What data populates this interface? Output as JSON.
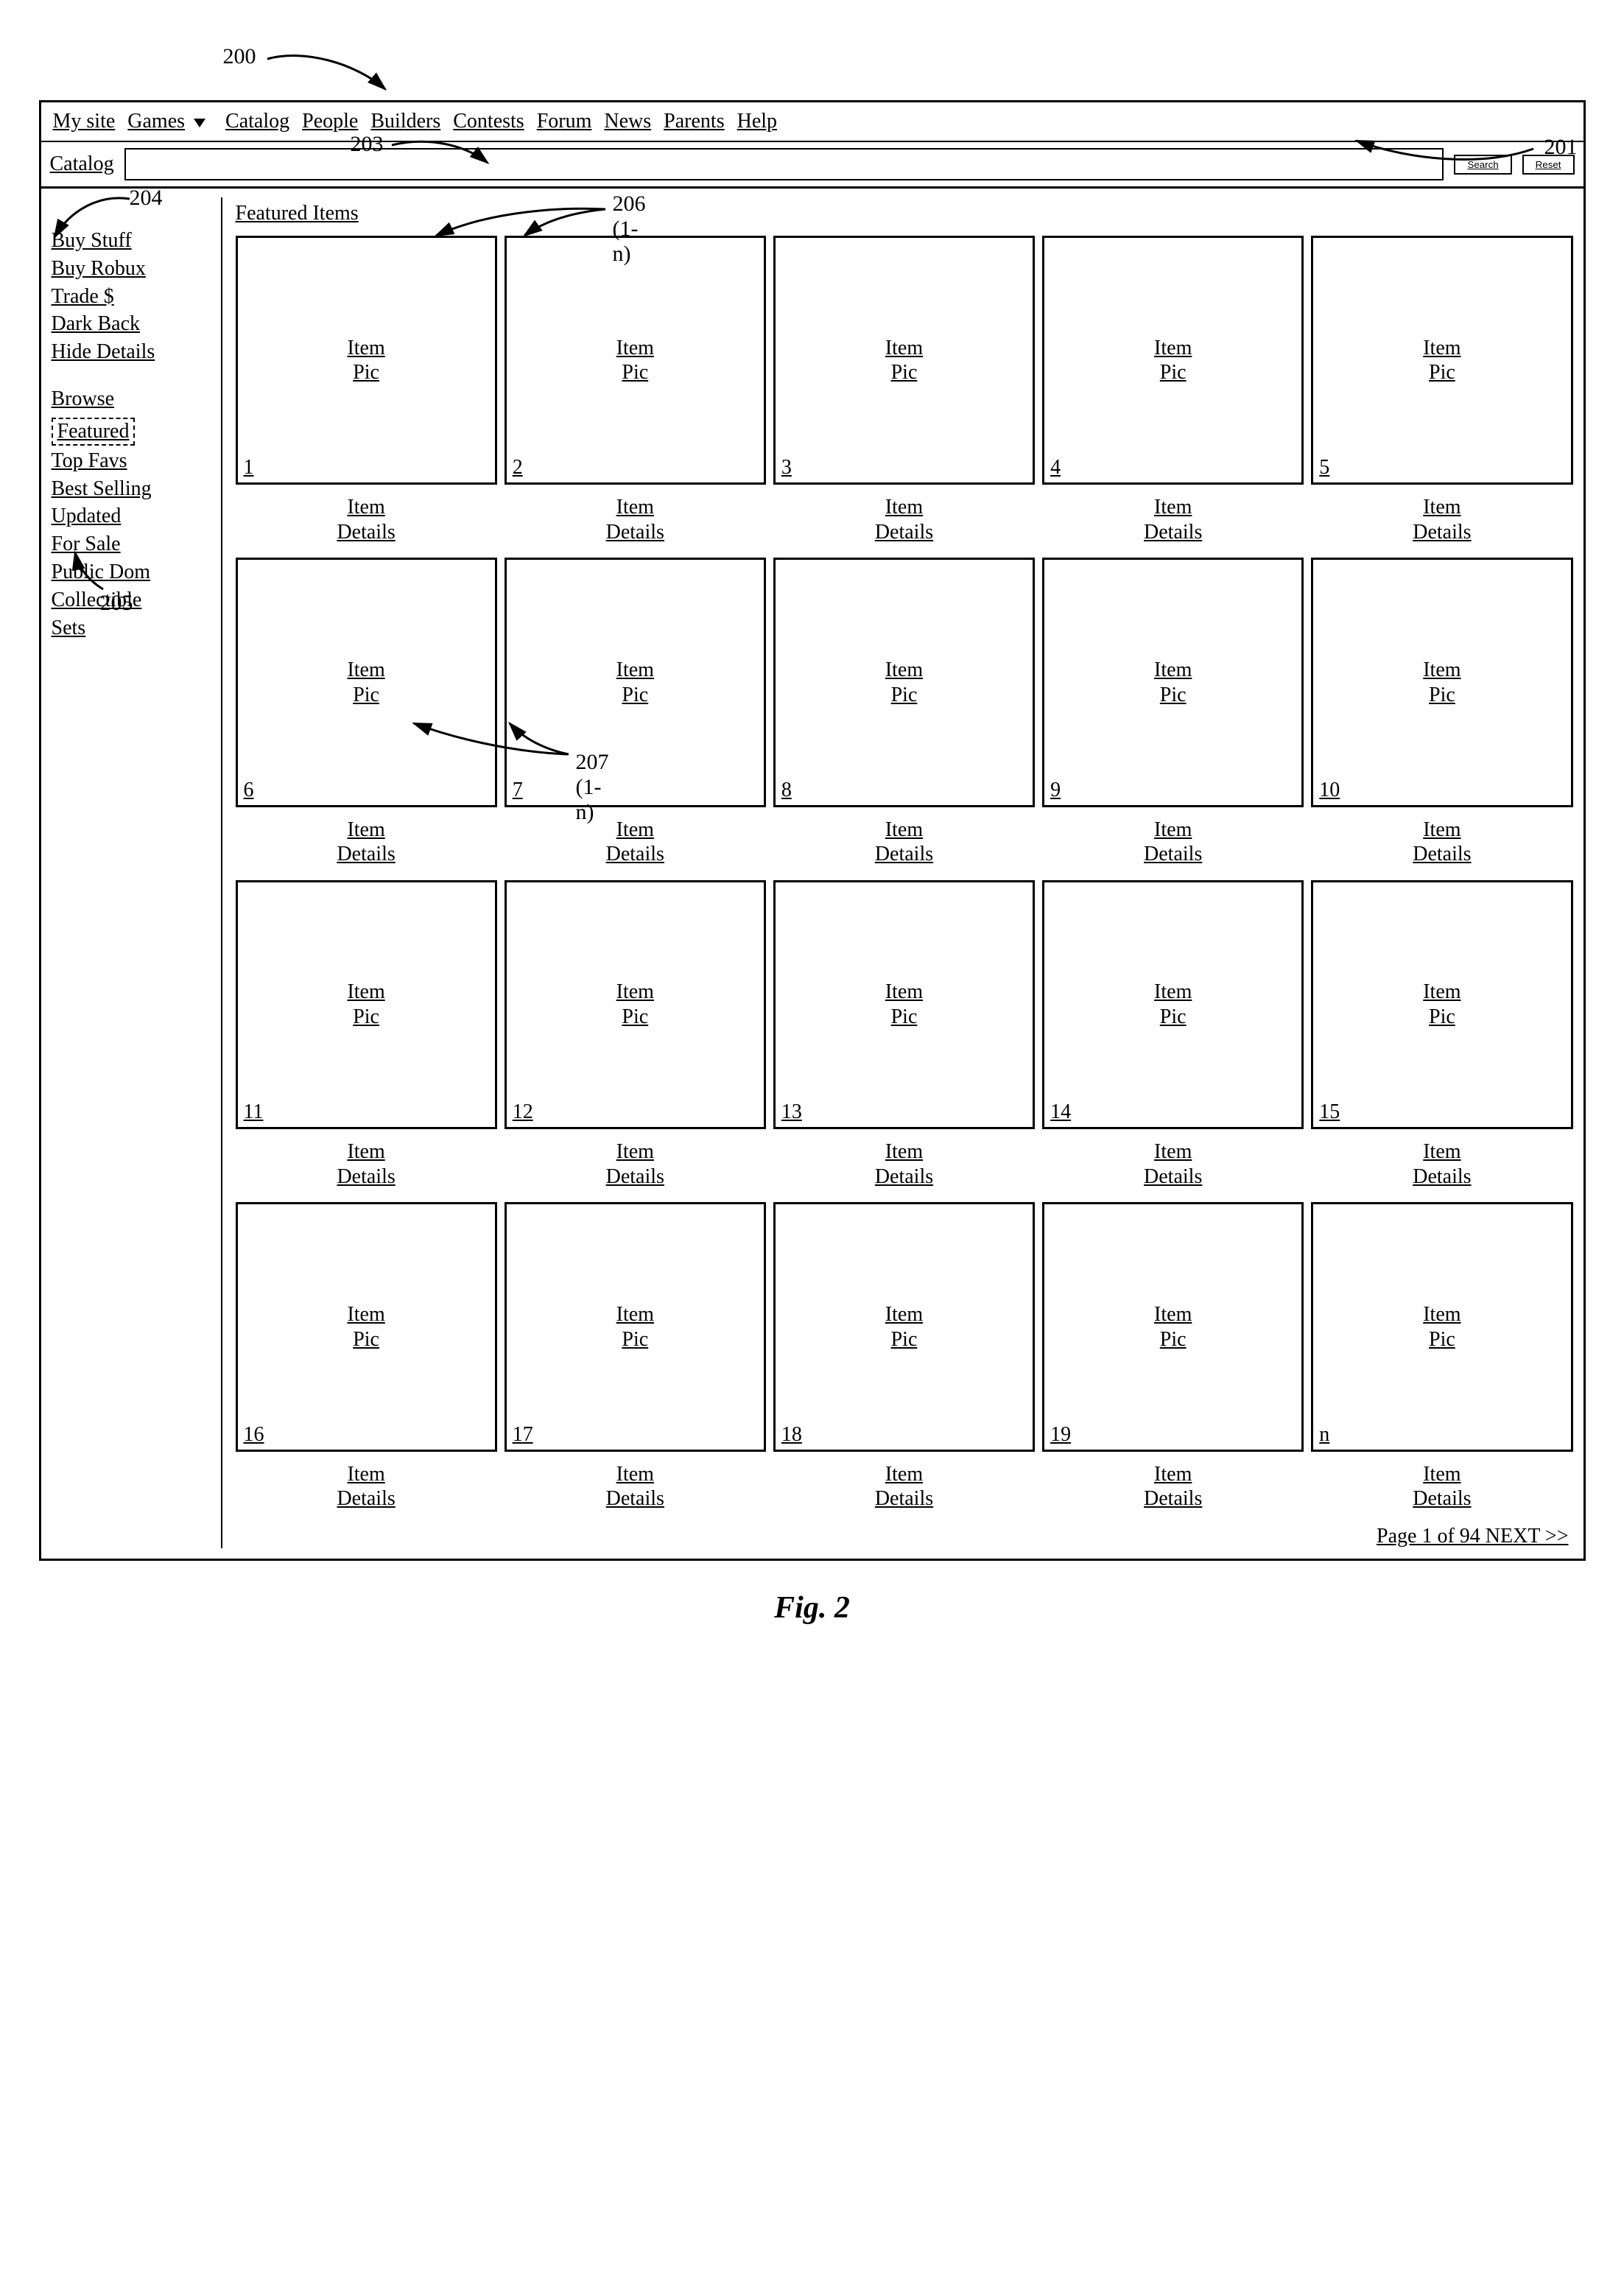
{
  "nav": {
    "items": [
      {
        "label": "My site",
        "dropdown": false
      },
      {
        "label": "Games",
        "dropdown": true
      },
      {
        "label": "Catalog",
        "dropdown": false
      },
      {
        "label": "People",
        "dropdown": false
      },
      {
        "label": "Builders",
        "dropdown": false
      },
      {
        "label": "Contests",
        "dropdown": false
      },
      {
        "label": "Forum",
        "dropdown": false
      },
      {
        "label": "News",
        "dropdown": false
      },
      {
        "label": "Parents",
        "dropdown": false
      },
      {
        "label": "Help",
        "dropdown": false
      }
    ]
  },
  "search": {
    "label": "Catalog",
    "search_btn": "Search",
    "reset_btn": "Reset",
    "value": ""
  },
  "sidebar": {
    "group1": [
      "Buy Stuff",
      "Buy Robux",
      "Trade $",
      "Dark Back",
      "Hide Details"
    ],
    "browse_label": "Browse",
    "featured_label": "Featured",
    "group2": [
      "Top Favs",
      "Best Selling",
      "Updated",
      "For Sale",
      "Public Dom",
      "Collectible",
      "Sets"
    ]
  },
  "content": {
    "section_title": "Featured Items",
    "pic_label_line1": "Item",
    "pic_label_line2": "Pic",
    "details_line1": "Item",
    "details_line2": "Details",
    "items": [
      {
        "n": "1"
      },
      {
        "n": "2"
      },
      {
        "n": "3"
      },
      {
        "n": "4"
      },
      {
        "n": "5"
      },
      {
        "n": "6"
      },
      {
        "n": "7"
      },
      {
        "n": "8"
      },
      {
        "n": "9"
      },
      {
        "n": "10"
      },
      {
        "n": "11"
      },
      {
        "n": "12"
      },
      {
        "n": "13"
      },
      {
        "n": "14"
      },
      {
        "n": "15"
      },
      {
        "n": "16"
      },
      {
        "n": "17"
      },
      {
        "n": "18"
      },
      {
        "n": "19"
      },
      {
        "n": "n"
      }
    ],
    "pager": "Page 1 of 94 NEXT >>"
  },
  "annotations": {
    "a200": "200",
    "a201": "201",
    "a203": "203",
    "a204": "204",
    "a205": "205",
    "a206": "206 (1-n)",
    "a207": "207 (1-n)"
  },
  "figure_caption": "Fig. 2"
}
